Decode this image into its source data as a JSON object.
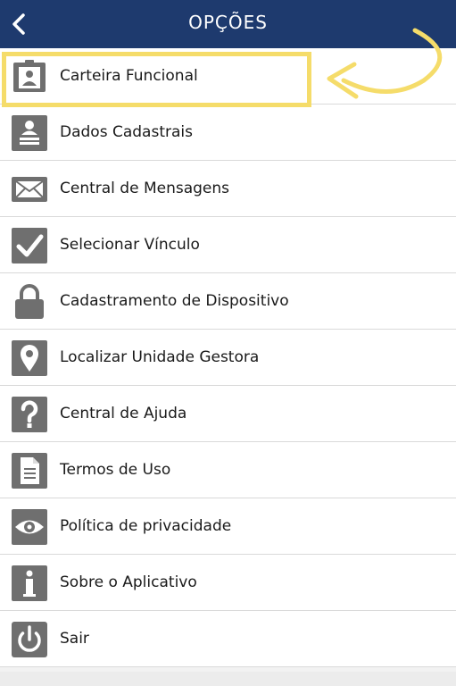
{
  "header": {
    "title": "OPÇÕES",
    "back_icon": "chevron-left-icon"
  },
  "menu": [
    {
      "label": "Carteira Funcional",
      "icon": "id-card-icon"
    },
    {
      "label": "Dados Cadastrais",
      "icon": "user-profile-icon"
    },
    {
      "label": "Central de Mensagens",
      "icon": "envelope-icon"
    },
    {
      "label": "Selecionar Vínculo",
      "icon": "checkmark-icon"
    },
    {
      "label": "Cadastramento de Dispositivo",
      "icon": "lock-icon"
    },
    {
      "label": "Localizar Unidade Gestora",
      "icon": "map-pin-icon"
    },
    {
      "label": "Central de Ajuda",
      "icon": "question-icon"
    },
    {
      "label": "Termos de Uso",
      "icon": "document-icon"
    },
    {
      "label": "Política de privacidade",
      "icon": "eye-icon"
    },
    {
      "label": "Sobre o Aplicativo",
      "icon": "info-icon"
    },
    {
      "label": "Sair",
      "icon": "power-icon"
    }
  ],
  "colors": {
    "header_bg": "#1e3a6e",
    "icon_gray": "#6f6f6f",
    "highlight": "#f5dc6a"
  }
}
